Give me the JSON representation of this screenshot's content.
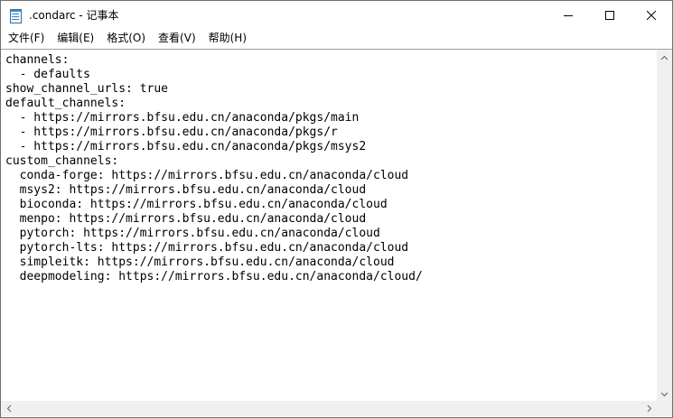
{
  "window": {
    "title": ".condarc - 记事本",
    "icon": "notepad-icon"
  },
  "caption_buttons": {
    "minimize_icon": "minimize-icon",
    "maximize_icon": "maximize-icon",
    "close_icon": "close-icon"
  },
  "menu": {
    "items": [
      {
        "label": "文件(F)"
      },
      {
        "label": "编辑(E)"
      },
      {
        "label": "格式(O)"
      },
      {
        "label": "查看(V)"
      },
      {
        "label": "帮助(H)"
      }
    ]
  },
  "editor": {
    "content": "channels:\n  - defaults\nshow_channel_urls: true\ndefault_channels:\n  - https://mirrors.bfsu.edu.cn/anaconda/pkgs/main\n  - https://mirrors.bfsu.edu.cn/anaconda/pkgs/r\n  - https://mirrors.bfsu.edu.cn/anaconda/pkgs/msys2\ncustom_channels:\n  conda-forge: https://mirrors.bfsu.edu.cn/anaconda/cloud\n  msys2: https://mirrors.bfsu.edu.cn/anaconda/cloud\n  bioconda: https://mirrors.bfsu.edu.cn/anaconda/cloud\n  menpo: https://mirrors.bfsu.edu.cn/anaconda/cloud\n  pytorch: https://mirrors.bfsu.edu.cn/anaconda/cloud\n  pytorch-lts: https://mirrors.bfsu.edu.cn/anaconda/cloud\n  simpleitk: https://mirrors.bfsu.edu.cn/anaconda/cloud\n  deepmodeling: https://mirrors.bfsu.edu.cn/anaconda/cloud/"
  }
}
